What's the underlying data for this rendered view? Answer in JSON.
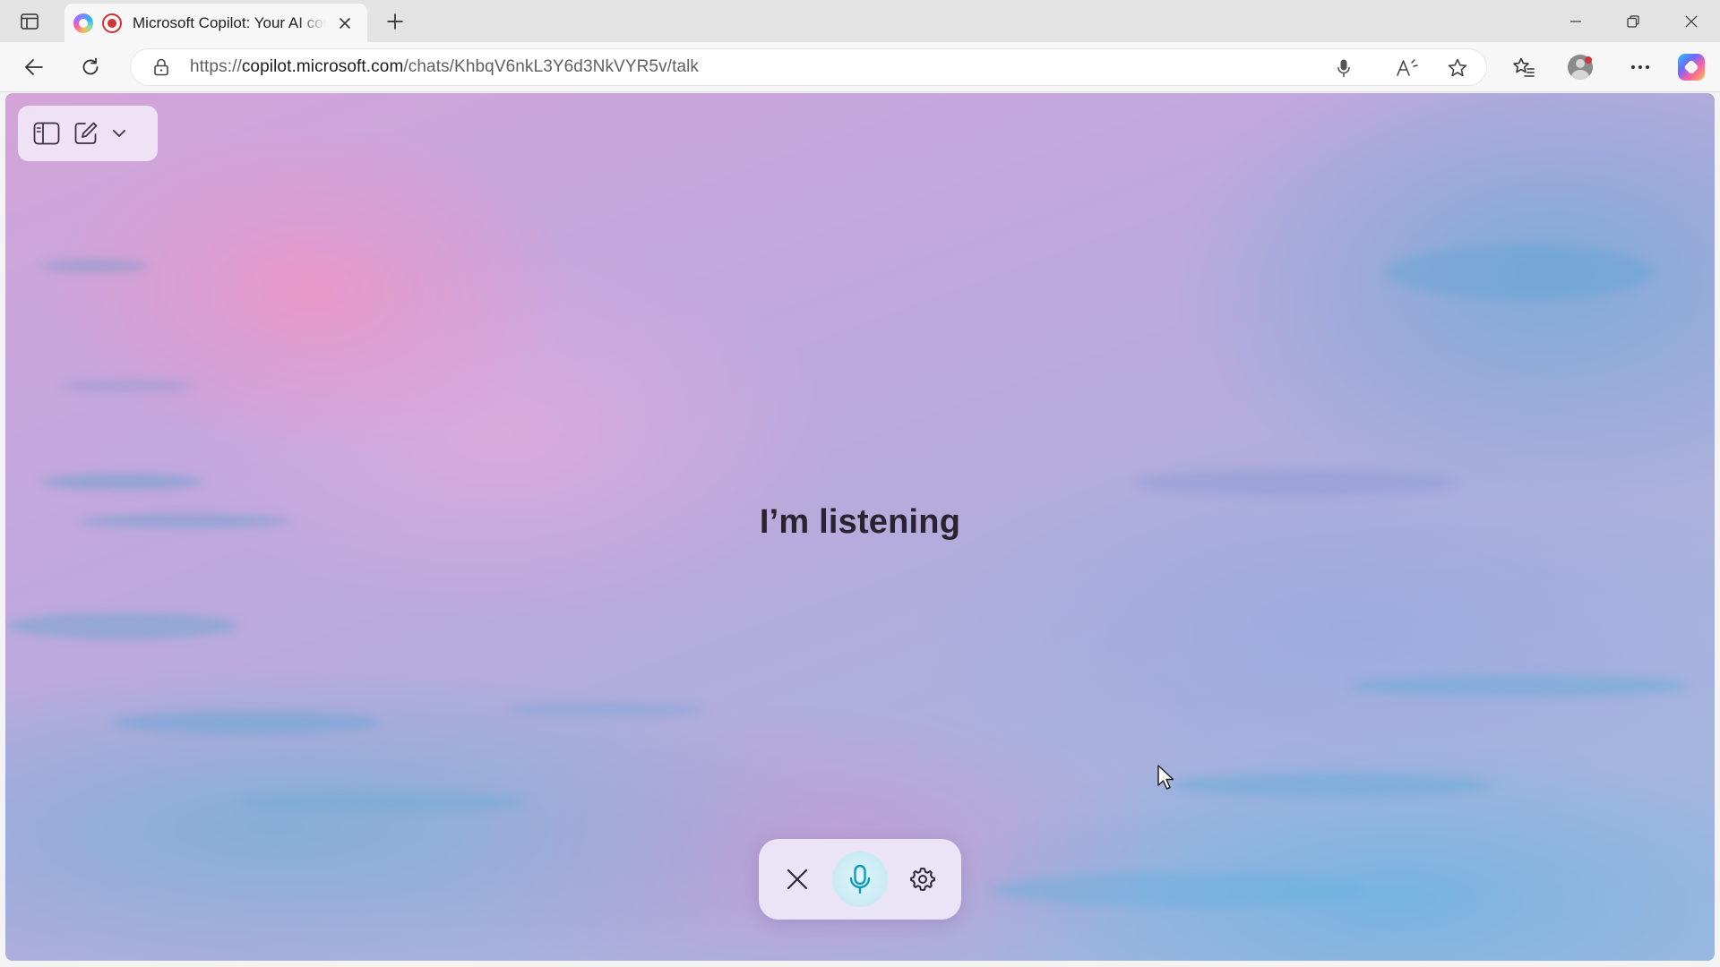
{
  "browser": {
    "tab": {
      "title": "Microsoft Copilot: Your AI companion"
    },
    "address_bar": {
      "url_prefix": "https://",
      "url_host": "copilot.microsoft.com",
      "url_path": "/chats/KhbqV6nkL3Y6d3NkVYR5v/talk"
    },
    "icons": {
      "tab_actions": "tab-actions-icon",
      "favicon": "copilot-favicon-icon",
      "recording": "recording-icon",
      "close_tab": "close-icon",
      "new_tab": "plus-icon",
      "back": "back-arrow-icon",
      "refresh": "refresh-icon",
      "lock": "lock-icon",
      "microphone": "microphone-icon",
      "read_aloud": "read-aloud-icon",
      "favorite": "star-icon",
      "favorites": "favorites-icon",
      "profile": "profile-icon",
      "more": "more-icon",
      "copilot": "copilot-icon"
    }
  },
  "page": {
    "status_text": "I’m listening",
    "accent_color": "#0f9bbd",
    "sidebar_controls": {
      "toggle_sidebar": "sidebar-icon",
      "new_chat": "compose-icon",
      "menu": "chevron-down-icon"
    },
    "voice_controls": {
      "end": "close-icon",
      "mic": "microphone-icon",
      "settings": "gear-icon"
    }
  }
}
